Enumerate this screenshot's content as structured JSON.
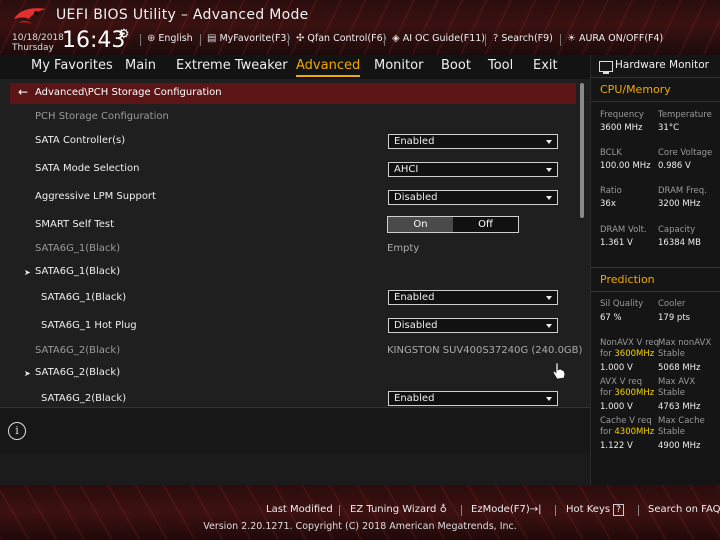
{
  "header": {
    "app_title": "UEFI BIOS Utility – Advanced Mode",
    "date": "10/18/2018",
    "day": "Thursday",
    "time": "16:43",
    "items": [
      {
        "icon": "globe-icon",
        "label": "English"
      },
      {
        "icon": "myfavorite-icon",
        "label": "MyFavorite(F3)"
      },
      {
        "icon": "fan-icon",
        "label": "Qfan Control(F6)"
      },
      {
        "icon": "ai-oc-guide-icon",
        "label": "AI OC Guide(F11)"
      },
      {
        "icon": "search-icon",
        "label": "Search(F9)"
      },
      {
        "icon": "aura-icon",
        "label": "AURA ON/OFF(F4)"
      }
    ]
  },
  "menu": {
    "tabs": [
      "My Favorites",
      "Main",
      "Extreme Tweaker",
      "Advanced",
      "Monitor",
      "Boot",
      "Tool",
      "Exit"
    ],
    "active": "Advanced"
  },
  "breadcrumb": "Advanced\\PCH Storage Configuration",
  "settings": {
    "section_title": "PCH Storage Configuration",
    "rows": [
      {
        "label": "SATA Controller(s)",
        "value": "Enabled"
      },
      {
        "label": "SATA Mode Selection",
        "value": "AHCI"
      },
      {
        "label": "Aggressive LPM Support",
        "value": "Disabled"
      },
      {
        "label": "SMART Self Test",
        "on": "On",
        "off": "Off",
        "selected": "On"
      },
      {
        "label": "SATA6G_1(Black)",
        "value": "Empty"
      },
      {
        "label": "SATA6G_1(Black)"
      },
      {
        "label": "SATA6G_1(Black)",
        "value": "Enabled"
      },
      {
        "label": "SATA6G_1 Hot Plug",
        "value": "Disabled"
      },
      {
        "label": "SATA6G_2(Black)",
        "value": "KINGSTON SUV400S37240G (240.0GB)"
      },
      {
        "label": "SATA6G_2(Black)"
      },
      {
        "label": "SATA6G_2(Black)",
        "value": "Enabled"
      }
    ]
  },
  "hardware_monitor": {
    "title": "Hardware Monitor",
    "cpu_memory": {
      "title": "CPU/Memory",
      "items": [
        {
          "label": "Frequency",
          "value": "3600 MHz"
        },
        {
          "label": "Temperature",
          "value": "31°C"
        },
        {
          "label": "BCLK",
          "value": "100.00 MHz"
        },
        {
          "label": "Core Voltage",
          "value": "0.986 V"
        },
        {
          "label": "Ratio",
          "value": "36x"
        },
        {
          "label": "DRAM Freq.",
          "value": "3200 MHz"
        },
        {
          "label": "DRAM Volt.",
          "value": "1.361 V"
        },
        {
          "label": "Capacity",
          "value": "16384 MB"
        }
      ]
    },
    "prediction": {
      "title": "Prediction",
      "items": [
        {
          "label": "Sil Quality",
          "value": "67 %"
        },
        {
          "label": "Cooler",
          "value": "179 pts"
        },
        {
          "label_a": "NonAVX V req",
          "label_b": "for",
          "freq": "3600MHz",
          "value": "1.000 V"
        },
        {
          "label_a": "Max nonAVX",
          "label_b": "Stable",
          "value": "5068 MHz"
        },
        {
          "label_a": "AVX V req",
          "label_b": "for",
          "freq": "3600MHz",
          "value": "1.000 V"
        },
        {
          "label_a": "Max AVX",
          "label_b": "Stable",
          "value": "4763 MHz"
        },
        {
          "label_a": "Cache V req",
          "label_b": "for",
          "freq": "4300MHz",
          "value": "1.122 V"
        },
        {
          "label_a": "Max Cache",
          "label_b": "Stable",
          "value": "4900 MHz"
        }
      ]
    }
  },
  "footer": {
    "items": [
      "Last Modified",
      "EZ Tuning Wizard",
      "EzMode(F7)",
      "Hot Keys",
      "Search on FAQ"
    ],
    "ez_mode_icon": "→|",
    "hot_keys_icon": "?",
    "copyright": "Version 2.20.1271. Copyright (C) 2018 American Megatrends, Inc."
  },
  "colors": {
    "accent": "#f2a900",
    "highlight": "#f2d200",
    "breadcrumb_bg": "#5b1517"
  }
}
